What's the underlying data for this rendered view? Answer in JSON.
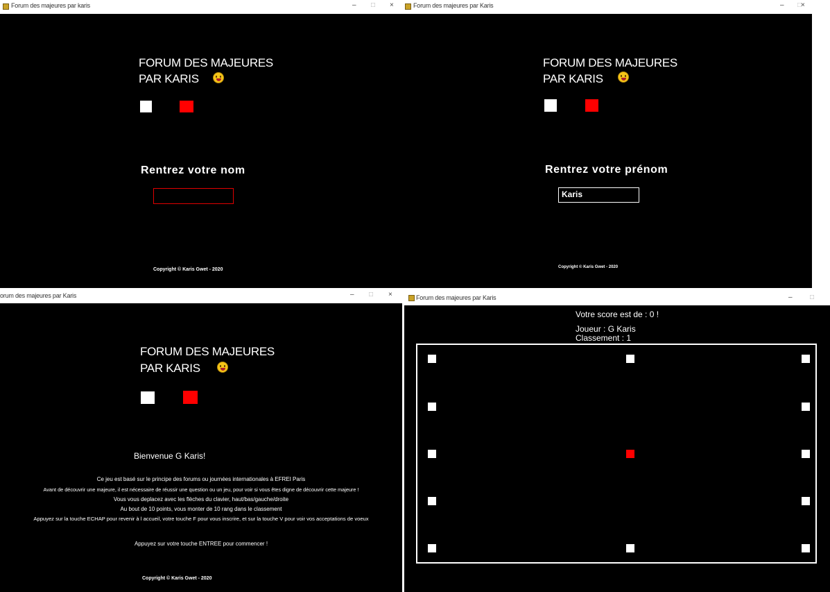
{
  "windows": [
    {
      "title": "Forum des majeures par karis",
      "controls": [
        "–",
        "□",
        "×"
      ]
    },
    {
      "title": "Forum des majeures par Karis",
      "controls": [
        "–",
        "□",
        "×"
      ]
    },
    {
      "title": "orum des majeures par Karis",
      "controls": [
        "–",
        "□",
        "×"
      ]
    },
    {
      "title": "Forum des majeures par Karis",
      "controls": [
        "–",
        "□"
      ]
    }
  ],
  "header": {
    "line1": "FORUM DES MAJEURES",
    "line2": "PAR KARIS"
  },
  "screen1": {
    "prompt": "Rentrez votre nom",
    "input_value": "",
    "copyright": "Copyright © Karis Gwet - 2020"
  },
  "screen2": {
    "prompt": "Rentrez votre prénom",
    "input_value": "Karis",
    "copyright": "Copyright © Karis Gwet - 2020"
  },
  "screen3": {
    "welcome": "Bienvenue G Karis!",
    "lines": [
      "Ce jeu est basé sur le principe des forums ou journées internationales à EFREI Paris",
      "Avant de découvrir une majeure, il est nécessaire de réussir une question ou un jeu, pour voir si vous êtes digne de découvrir cette majeure !",
      "Vous vous deplacez avec les flèches du clavier, haut/bas/gauche/droite",
      "Au bout de 10 points, vous monter de 10 rang dans le classement",
      "Appuyez sur la touche ECHAP pour revenir à l accueil, votre touche F pour vous inscrire, et sur la touche V pour voir vos acceptations de voeux"
    ],
    "start": "Appuyez sur votre touche ENTREE pour commencer !",
    "copyright": "Copyright © Karis Gwet - 2020"
  },
  "screen4": {
    "score": "Votre score est de : 0 !",
    "player": "Joueur : G Karis",
    "rank": "Classement : 1",
    "grid": {
      "rows": 5,
      "cols": 3,
      "player_row": 2,
      "player_col": 1
    }
  },
  "colors": {
    "background": "#000000",
    "accent": "#ff0000",
    "foreground": "#ffffff"
  },
  "icons": [
    "app-icon",
    "smiley-emoji-icon"
  ]
}
